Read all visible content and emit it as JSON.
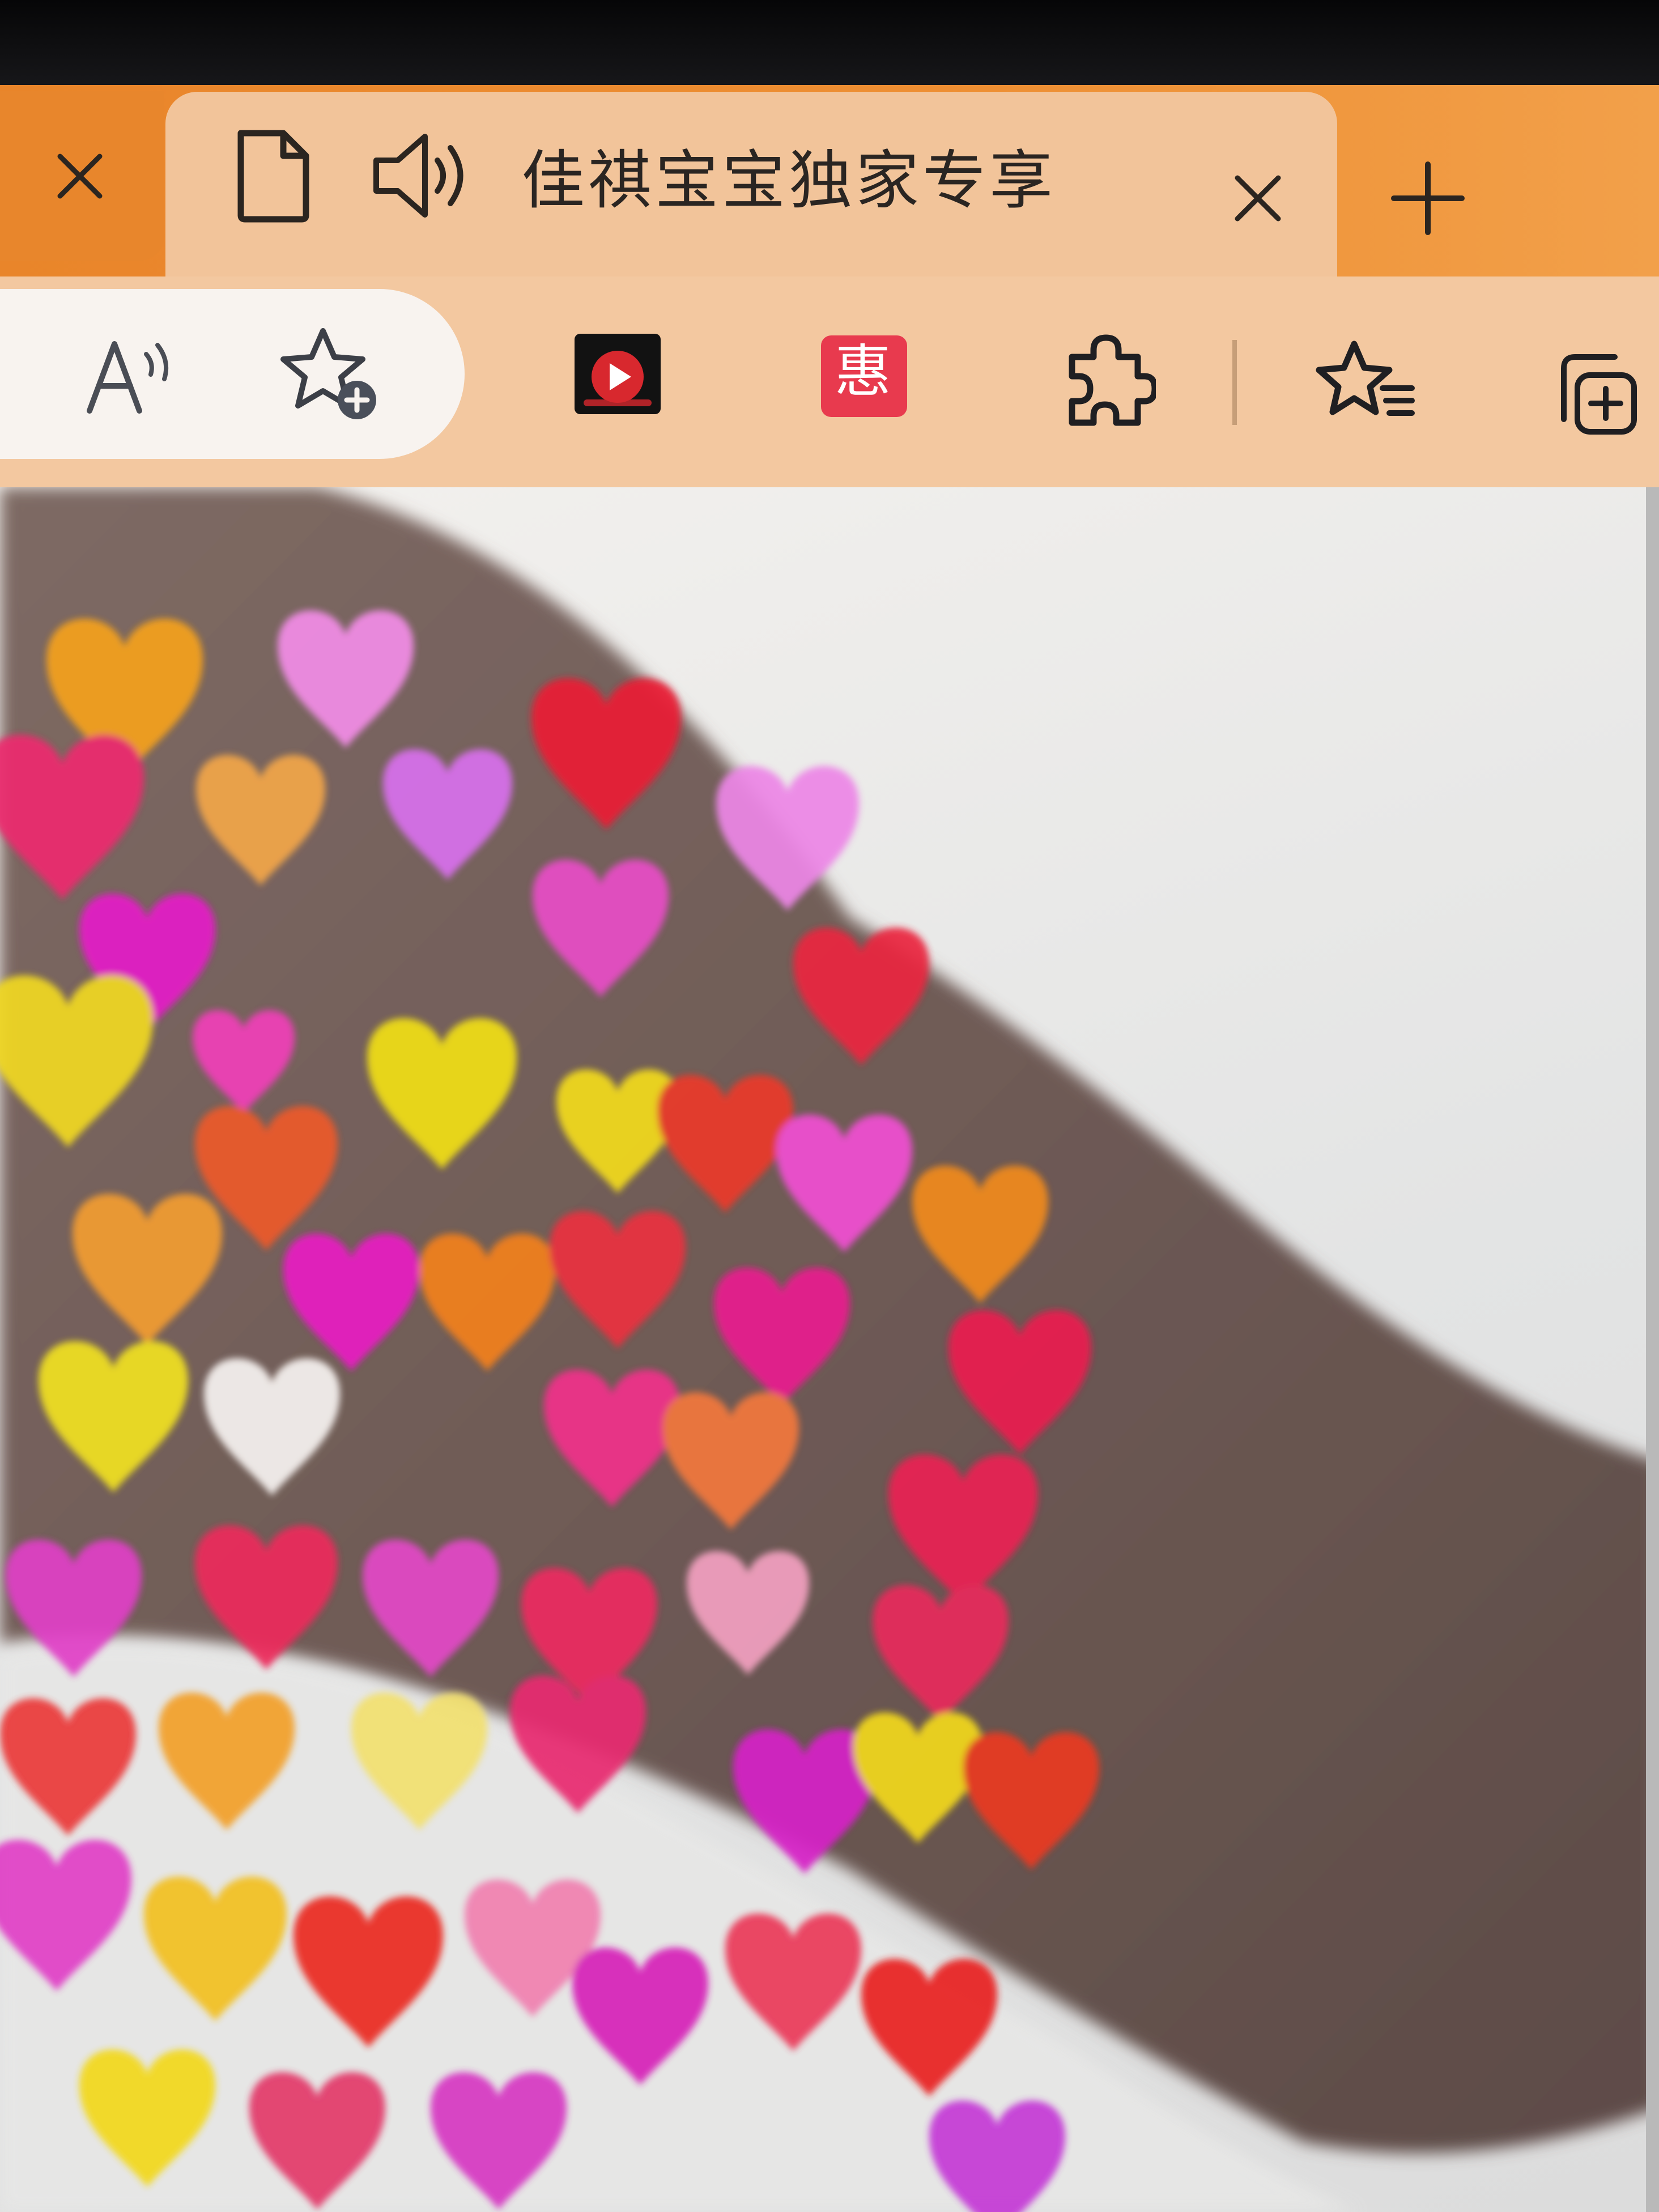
{
  "browser": {
    "tabs": [
      {
        "title": ""
      },
      {
        "title": "佳祺宝宝独家专享",
        "playing_audio": true,
        "active": true
      }
    ],
    "new_tab_label": "+",
    "toolbar": {
      "address_icons": [
        "read-aloud-icon",
        "add-favorite-icon"
      ],
      "extensions": [
        {
          "name": "video-extension-icon",
          "color": "#d8282e"
        },
        {
          "name": "coupon-extension-icon",
          "label": "惠",
          "color": "#e83a4e"
        }
      ],
      "actions": [
        "extensions-icon",
        "favorites-icon",
        "collections-icon"
      ]
    },
    "colors": {
      "tab_strip": "#ee8f33",
      "active_tab": "#f2c49a",
      "toolbar": "#f3c8a0"
    }
  },
  "page": {
    "content": "photo-with-heart-overlay"
  }
}
